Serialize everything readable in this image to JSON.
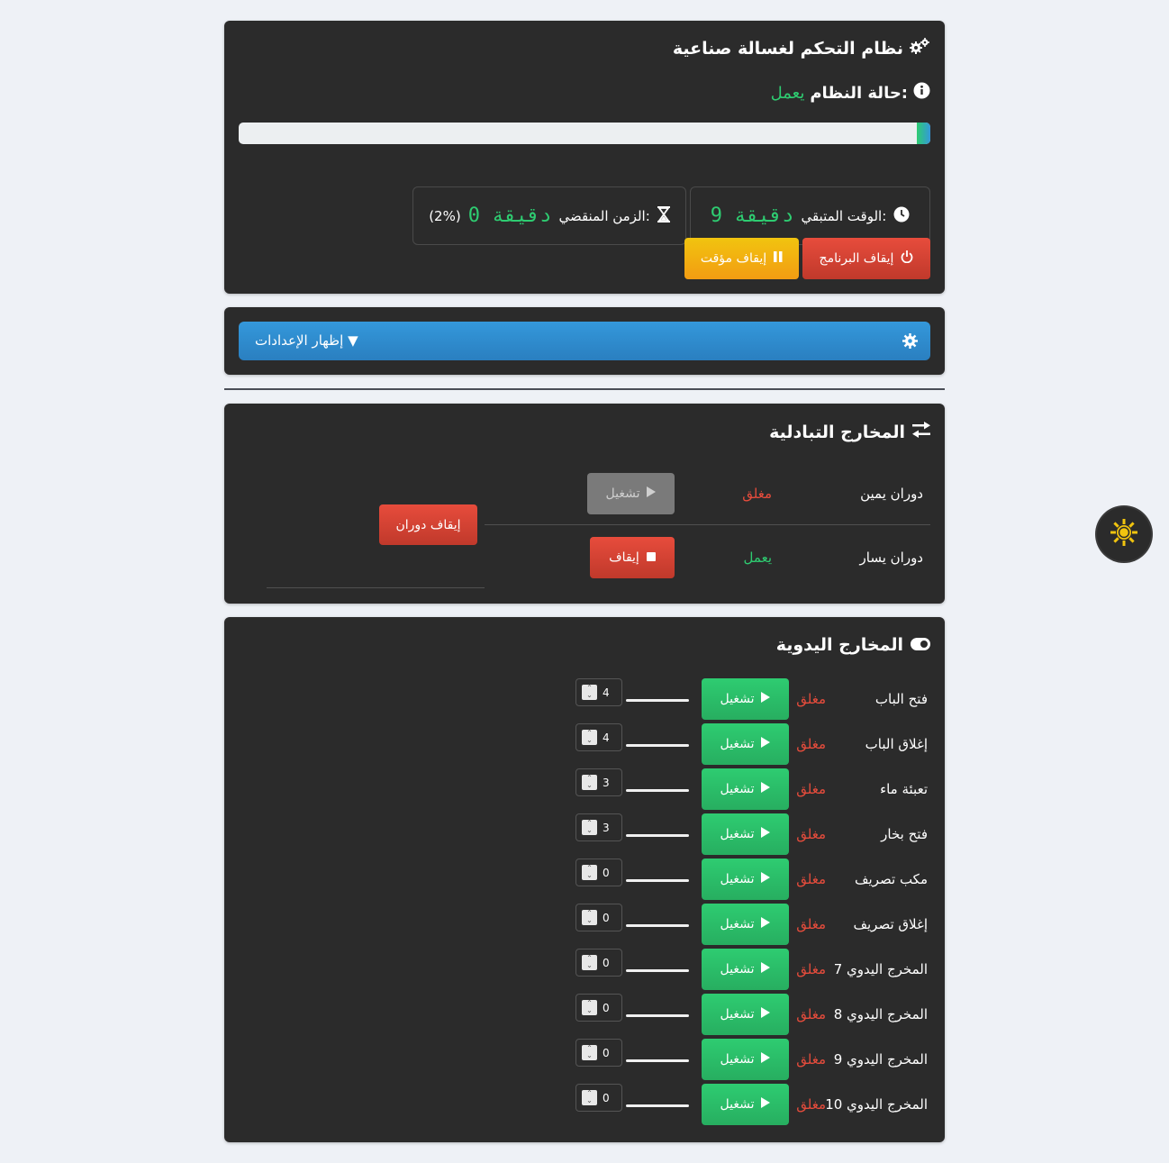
{
  "header": {
    "title": "نظام التحكم لغسالة صناعية",
    "status_label": "حالة النظام:",
    "status_value": "يعمل",
    "progress_percent": 2
  },
  "timers": {
    "remaining_label": "الوقت المتبقي:",
    "remaining_value": "9 دقيقة",
    "elapsed_label": "الزمن المنقضي:",
    "elapsed_value": "0 دقيقة",
    "elapsed_percent": "(2%)"
  },
  "controls": {
    "stop_program": "إيقاف البرنامج",
    "pause": "إيقاف مؤقت"
  },
  "settings": {
    "toggle_label": "إظهار الإعدادات ▼"
  },
  "alternating": {
    "title": "المخارج التبادلية",
    "stop_rotation": "إيقاف دوران",
    "rows": [
      {
        "label": "دوران يمين",
        "status": "مغلق",
        "button": "تشغيل"
      },
      {
        "label": "دوران يسار",
        "status": "يعمل",
        "button": "إيقاف"
      }
    ]
  },
  "manual": {
    "title": "المخارج اليدوية",
    "rows": [
      {
        "label": "فتح الباب",
        "status": "مغلق",
        "button": "تشغيل",
        "value": "4"
      },
      {
        "label": "إغلاق الباب",
        "status": "مغلق",
        "button": "تشغيل",
        "value": "4"
      },
      {
        "label": "تعبئة ماء",
        "status": "مغلق",
        "button": "تشغيل",
        "value": "3"
      },
      {
        "label": "فتح بخار",
        "status": "مغلق",
        "button": "تشغيل",
        "value": "3"
      },
      {
        "label": "مكب تصريف",
        "status": "مغلق",
        "button": "تشغيل",
        "value": "0"
      },
      {
        "label": "إغلاق تصريف",
        "status": "مغلق",
        "button": "تشغيل",
        "value": "0"
      },
      {
        "label": "المخرج اليدوي 7",
        "status": "مغلق",
        "button": "تشغيل",
        "value": "0"
      },
      {
        "label": "المخرج اليدوي 8",
        "status": "مغلق",
        "button": "تشغيل",
        "value": "0"
      },
      {
        "label": "المخرج اليدوي 9",
        "status": "مغلق",
        "button": "تشغيل",
        "value": "0"
      },
      {
        "label": "المخرج اليدوي 10",
        "status": "مغلق",
        "button": "تشغيل",
        "value": "0"
      }
    ]
  },
  "colors": {
    "accent_green": "#2ecc71",
    "accent_red": "#e74c3c",
    "accent_yellow": "#f1c40f",
    "accent_blue": "#3498db"
  }
}
